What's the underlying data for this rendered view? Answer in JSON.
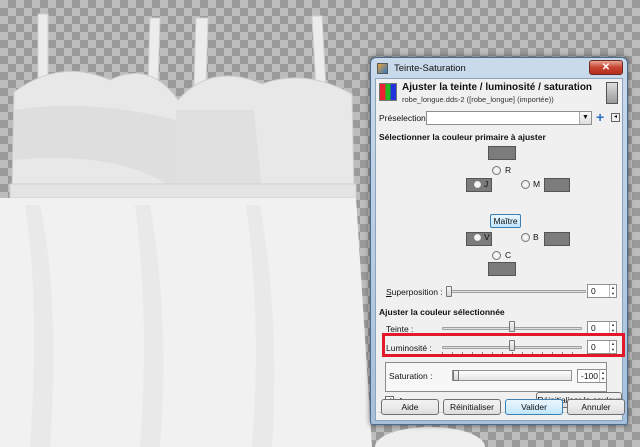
{
  "dialog": {
    "title": "Teinte-Saturation",
    "close_label": "✕",
    "header_title": "Ajuster la teinte / luminosité / saturation",
    "header_subtitle": "robe_longue.dds-2 ([robe_longue] (importée))",
    "presets_label": "Préselections :",
    "presets_value": "",
    "primary_section_title": "Sélectionner la couleur primaire à ajuster",
    "colors": {
      "r": "R",
      "j": "J",
      "m": "M",
      "v": "V",
      "b": "B",
      "c": "C"
    },
    "master_label": "Maître",
    "overlap_label": "Superposition :",
    "overlap_value": "0",
    "overlap_level": 0,
    "adjust_section_title": "Ajuster la couleur sélectionnée",
    "hue_label": "Teinte :",
    "hue_value": "0",
    "hue_level": 0.5,
    "lightness_label": "Luminosité :",
    "lightness_value": "0",
    "lightness_level": 0.5,
    "saturation_label": "Saturation :",
    "saturation_value": "-100",
    "saturation_level": 0,
    "reset_color_label": "Réinitialiser la couleur",
    "preview_label": "Aperçu",
    "preview_checked": true,
    "buttons": {
      "help": "Aide",
      "reset": "Réinitialiser",
      "ok": "Valider",
      "cancel": "Annuler"
    }
  },
  "colors": {
    "highlight": "#e3182b",
    "swatch": "#7c7c7c"
  }
}
